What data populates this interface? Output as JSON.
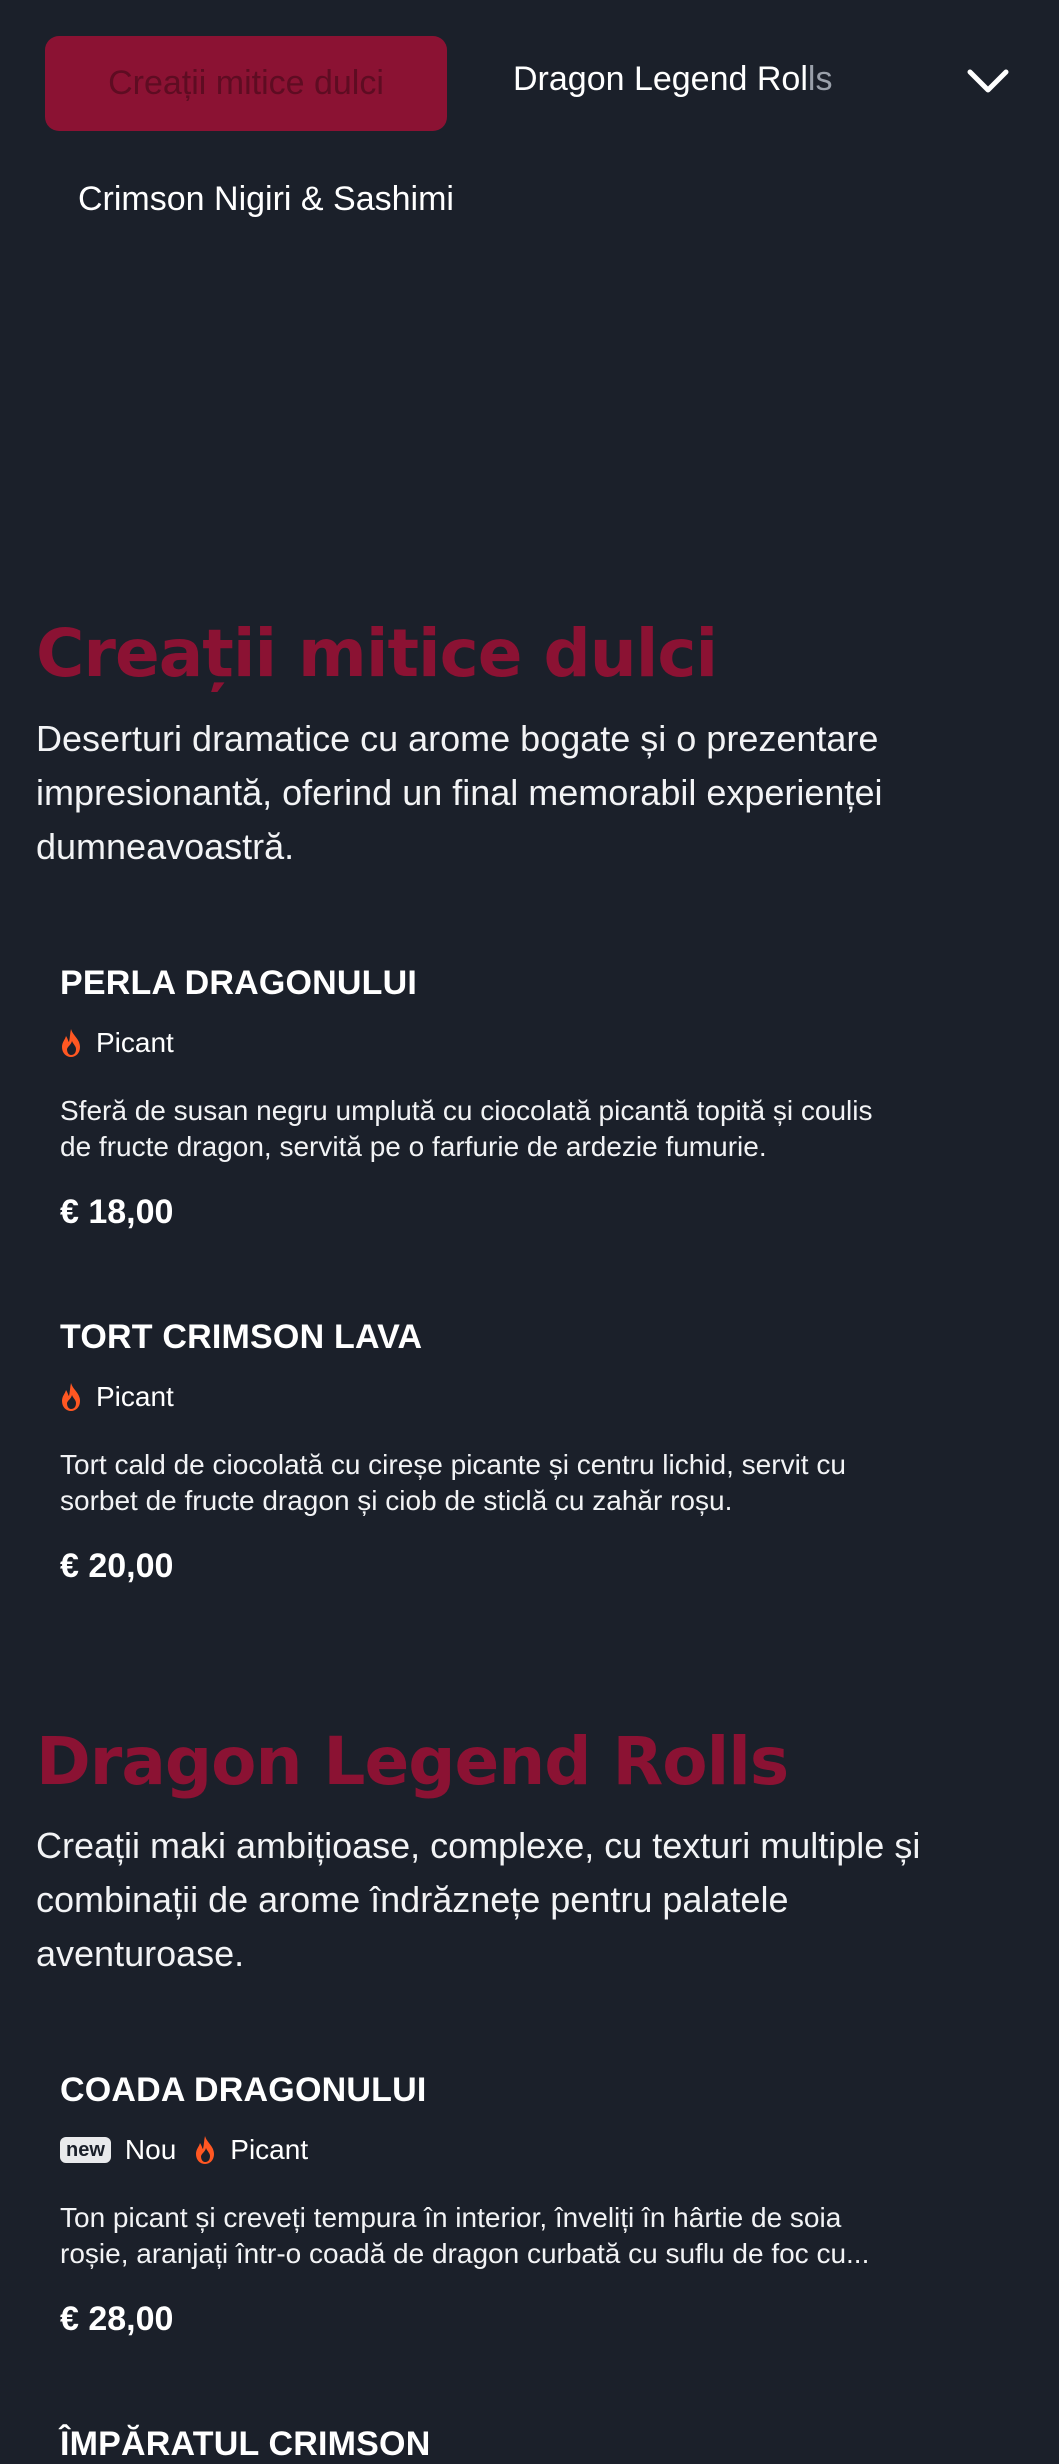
{
  "nav": {
    "tabs": [
      {
        "label": "Creații mitice dulci"
      },
      {
        "label": "Dragon Legend Rol",
        "label_fade": "ls"
      },
      {
        "label": "Crimson Nigiri & Sashimi"
      }
    ],
    "expand_icon": "chevron-down-icon"
  },
  "categories": [
    {
      "title": "Creații mitice dulci",
      "description_lines": [
        "Deserturi dramatice cu arome bogate și o prezentare",
        "impresionantă, oferind un final memorabil experienței",
        "dumneavoastră."
      ],
      "items": [
        {
          "name": "PERLA DRAGONULUI",
          "tags": [
            "Picant"
          ],
          "description_lines": [
            "Sferă de susan negru umplută cu ciocolată picantă topită și coulis",
            "de fructe dragon, servită pe o farfurie de ardezie fumurie."
          ],
          "price": "€ 18,00"
        },
        {
          "name": "TORT CRIMSON LAVA",
          "tags": [
            "Picant"
          ],
          "description_lines": [
            "Tort cald de ciocolată cu cireșe picante și centru lichid, servit cu",
            "sorbet de fructe dragon și ciob de sticlă cu zahăr roșu."
          ],
          "price": "€ 20,00"
        }
      ]
    },
    {
      "title": "Dragon Legend Rolls",
      "description_lines": [
        "Creații maki ambițioase, complexe, cu texturi multiple și",
        "combinații de arome îndrăznețe pentru palatele",
        "aventuroase."
      ],
      "items": [
        {
          "name": "COADA DRAGONULUI",
          "badge": "new",
          "tags": [
            "Nou",
            "Picant"
          ],
          "description_lines": [
            "Ton picant și creveți tempura în interior, înveliți în hârtie de soia",
            "roșie, aranjați într-o coadă de dragon curbată cu suflu de foc cu..."
          ],
          "price": "€ 28,00"
        },
        {
          "name": "ÎMPĂRATUL CRIMSON"
        }
      ]
    }
  ],
  "colors": {
    "background": "#1b202a",
    "accent": "#8b1233",
    "flame": "#ff5722"
  }
}
